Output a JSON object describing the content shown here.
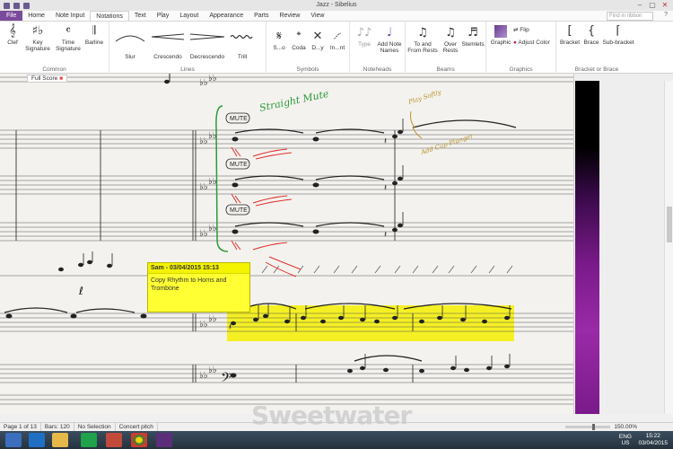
{
  "window": {
    "title": "Jazz - Sibelius"
  },
  "menu": {
    "tabs": [
      "File",
      "Home",
      "Note Input",
      "Notations",
      "Text",
      "Play",
      "Layout",
      "Appearance",
      "Parts",
      "Review",
      "View"
    ],
    "search_placeholder": "Find in ribbon"
  },
  "ribbon": {
    "common": {
      "name": "Common",
      "clef": "Clef",
      "key": "Key Signature",
      "time": "Time Signature",
      "barline": "Barline"
    },
    "lines": {
      "name": "Lines",
      "slur": "Slur",
      "crescendo": "Crescendo",
      "decrescendo": "Decrescendo",
      "trill": "Trill"
    },
    "symbols": {
      "name": "Symbols",
      "segno": "S...o",
      "coda": "Coda",
      "dy": "D...y",
      "int": "In...nt"
    },
    "noteheads": {
      "name": "Noteheads",
      "type": "Type",
      "add_note_names": "Add Note Names"
    },
    "beams": {
      "name": "Beams",
      "to_from_rests": "To and From Rests",
      "over_rests": "Over Rests",
      "stemlets": "Stemlets"
    },
    "graphics": {
      "name": "Graphics",
      "graphic": "Graphic",
      "flip": "Flip",
      "adjust_color": "Adjust Color"
    },
    "bracket": {
      "name": "Bracket or Brace",
      "bracket": "Bracket",
      "brace": "Brace",
      "sub_bracket": "Sub-bracket"
    }
  },
  "score_tab": "Full Score",
  "score": {
    "mute_labels": [
      "MUTE",
      "MUTE",
      "MUTE"
    ],
    "handwriting_green": "Straight Mute",
    "handwriting_gold_1": "Play Softly",
    "handwriting_gold_2": "Add Cup Plunger"
  },
  "comment": {
    "header": "Sam - 03/04/2015 15:13",
    "body": "Copy Rhythm to Horns and Trombone"
  },
  "status": {
    "page": "Page 1 of 13",
    "bars": "Bars: 120",
    "selection": "No Selection",
    "pitch": "Concert pitch",
    "zoom": "150.00%"
  },
  "taskbar": {
    "lang": "ENG",
    "region": "US",
    "time": "15:22",
    "date": "03/04/2015"
  },
  "watermark": "Sweetwater",
  "colors": {
    "accent": "#7a4b9a",
    "highlight": "#f5f000",
    "note": "#ffff33"
  }
}
